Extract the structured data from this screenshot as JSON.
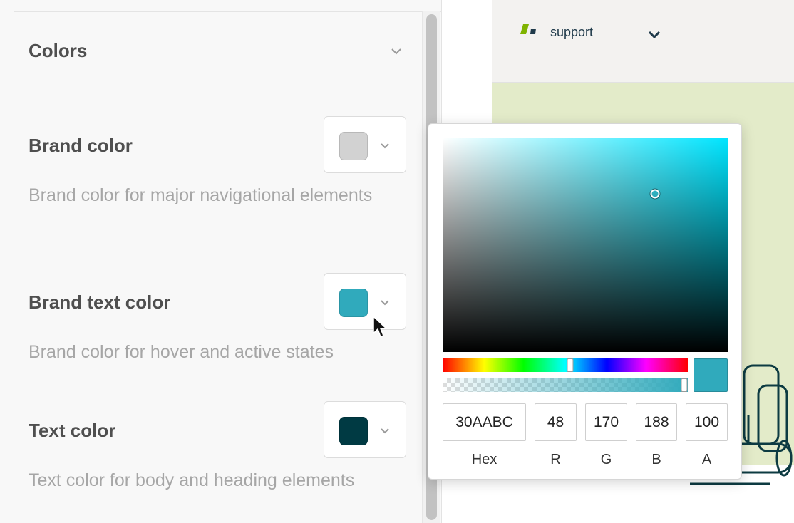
{
  "section": {
    "title": "Colors"
  },
  "settings": [
    {
      "label": "Brand color",
      "description": "Brand color for major navigational elements",
      "swatch": "#d2d2d2"
    },
    {
      "label": "Brand text color",
      "description": "Brand color for hover and active states",
      "swatch": "#30aabc"
    },
    {
      "label": "Text color",
      "description": "Text color for body and heading elements",
      "swatch": "#003a43"
    }
  ],
  "preview": {
    "brand_name": "support",
    "colors": {
      "header_bg": "#f3f2f0",
      "hero_bg": "#e3ebc9",
      "logo": "#7fb300"
    }
  },
  "picker": {
    "hex": "30AABC",
    "r": "48",
    "g": "170",
    "b": "188",
    "a": "100",
    "labels": {
      "hex": "Hex",
      "r": "R",
      "g": "G",
      "b": "B",
      "a": "A"
    },
    "hue_fraction": 0.519,
    "saturation": 1.0,
    "value": 0.74,
    "alpha_fraction": 1.0
  },
  "icons": {
    "section_toggle": "chevron-down-icon",
    "swatch_toggle": "chevron-down-icon",
    "header_toggle": "chevron-down-icon",
    "pointer": "mouse-pointer-icon"
  }
}
